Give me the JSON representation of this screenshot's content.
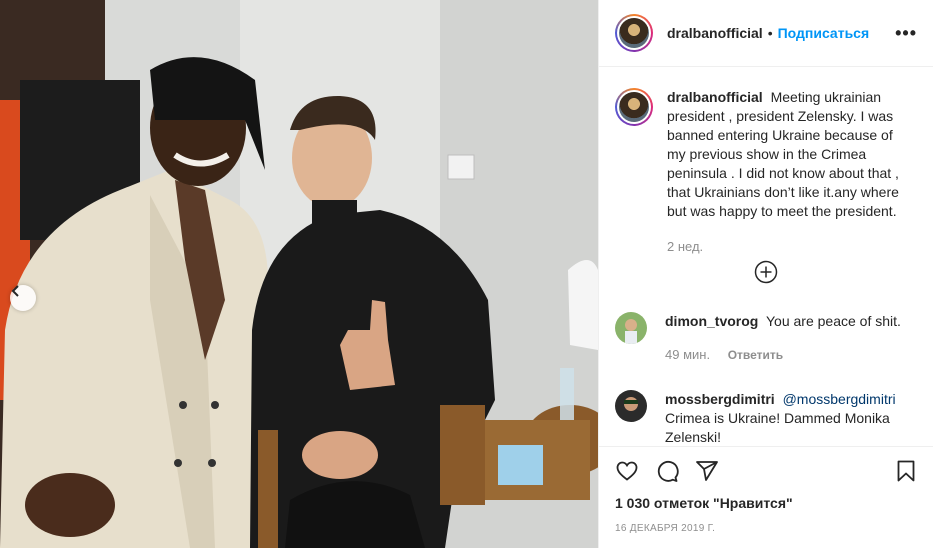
{
  "header": {
    "username": "dralbanofficial",
    "separator": "•",
    "follow_label": "Подписаться",
    "more_label": "•••"
  },
  "caption": {
    "username": "dralbanofficial",
    "text": "Meeting ukrainian president , president Zelensky. I was banned entering Ukraine because of my previous show in the Crimea peninsula . I did not know about that , that Ukrainians don’t like it.any where but was happy to meet the president.",
    "time": "2 нед."
  },
  "comments": [
    {
      "username": "dimon_tvorog",
      "text": "You are peace of shit.",
      "time": "49 мин.",
      "reply_label": "Ответить"
    },
    {
      "username": "mossbergdimitri",
      "mention": "@mossbergdimitri",
      "text": "Crimea is Ukraine! Dammed Monika Zelenski!"
    }
  ],
  "actions": {
    "icons": [
      "heart-icon",
      "comment-icon",
      "share-icon",
      "bookmark-icon"
    ],
    "likes": "1 030 отметок \"Нравится\"",
    "date": "16 ДЕКАБРЯ 2019 Г."
  },
  "colors": {
    "accent": "#0095f6",
    "text": "#262626",
    "muted": "#8e8e8e",
    "border": "#efefef"
  }
}
